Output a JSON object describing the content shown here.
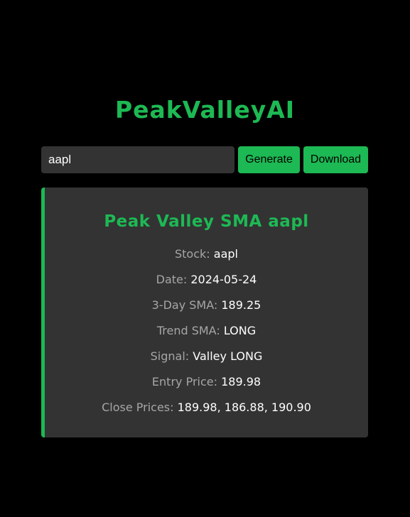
{
  "app": {
    "title": "PeakValleyAI"
  },
  "search": {
    "value": "aapl",
    "placeholder": ""
  },
  "buttons": {
    "generate_label": "Generate",
    "download_label": "Download"
  },
  "result": {
    "title": "Peak Valley SMA aapl",
    "rows": [
      {
        "label": "Stock:",
        "value": "aapl"
      },
      {
        "label": "Date:",
        "value": "2024-05-24"
      },
      {
        "label": "3-Day SMA:",
        "value": "189.25"
      },
      {
        "label": "Trend SMA:",
        "value": "LONG"
      },
      {
        "label": "Signal:",
        "value": "Valley LONG"
      },
      {
        "label": "Entry Price:",
        "value": "189.98"
      },
      {
        "label": "Close Prices:",
        "value": "189.98, 186.88, 190.90"
      }
    ]
  },
  "colors": {
    "background": "#000000",
    "accent": "#1db954",
    "panel": "#333333",
    "label": "#a6a6a6",
    "value": "#ffffff"
  }
}
